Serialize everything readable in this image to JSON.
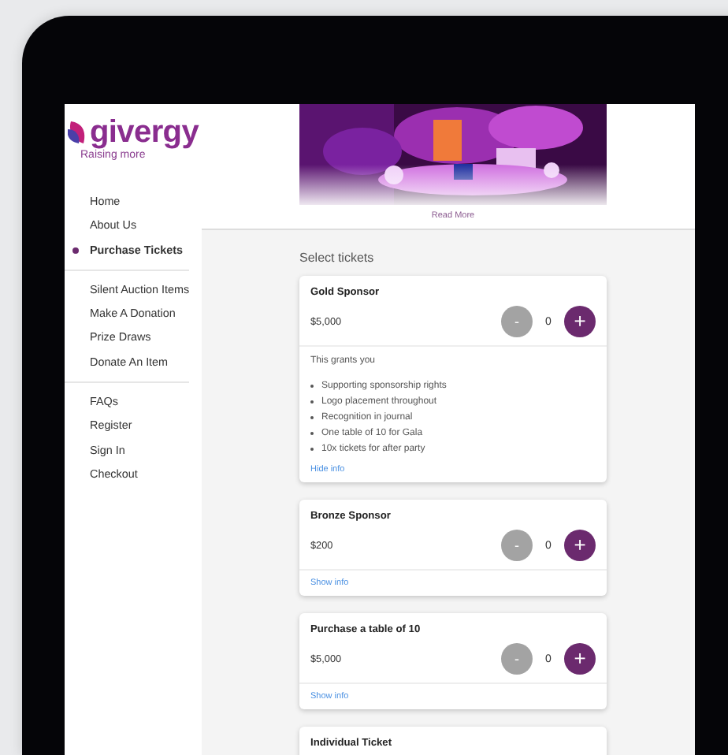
{
  "sidebar": {
    "logo": {
      "wordmark": "givergy",
      "tagline": "Raising more"
    },
    "nav_groups": [
      [
        {
          "label": "Home",
          "selected": false
        },
        {
          "label": "About Us",
          "selected": false
        },
        {
          "label": "Purchase Tickets",
          "selected": true
        }
      ],
      [
        {
          "label": "Silent Auction Items",
          "selected": false
        },
        {
          "label": "Make A Donation",
          "selected": false
        },
        {
          "label": "Prize Draws",
          "selected": false
        },
        {
          "label": "Donate An Item",
          "selected": false
        }
      ],
      [
        {
          "label": "FAQs",
          "selected": false
        },
        {
          "label": "Register",
          "selected": false
        },
        {
          "label": "Sign In",
          "selected": false
        },
        {
          "label": "Checkout",
          "selected": false
        }
      ]
    ]
  },
  "hero": {
    "kind": "picture",
    "read_more": "Read More"
  },
  "section_title": "Select tickets",
  "tickets": [
    {
      "name": "Gold Sponsor",
      "price": "$5,000",
      "quantity": "0",
      "minus": "-",
      "plus": "+",
      "minus_disabled": true,
      "expanded": true,
      "info_heading": "This grants you",
      "info_items": [
        "Supporting sponsorship rights",
        "Logo placement throughout",
        "Recognition in journal",
        "One table of 10 for Gala",
        "10x tickets for after party"
      ],
      "toggle": "Hide info"
    },
    {
      "name": "Bronze Sponsor",
      "price": "$200",
      "quantity": "0",
      "minus": "-",
      "plus": "+",
      "minus_disabled": true,
      "expanded": false,
      "toggle": "Show info"
    },
    {
      "name": "Purchase a table of 10",
      "price": "$5,000",
      "quantity": "0",
      "minus": "-",
      "plus": "+",
      "minus_disabled": true,
      "expanded": false,
      "toggle": "Show info"
    },
    {
      "name": "Individual Ticket"
    }
  ]
}
